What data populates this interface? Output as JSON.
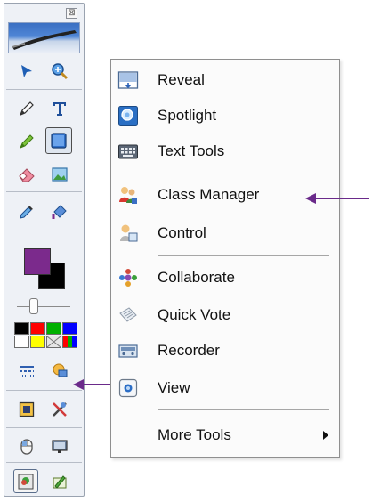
{
  "toolbox": {
    "close_glyph": "⊠",
    "icons": [
      "select-arrow-icon",
      "zoom-icon",
      "pen-icon",
      "text-icon",
      "highlighter-icon",
      "shape-icon",
      "eraser-icon",
      "image-icon",
      "eyedropper-icon",
      "fill-icon",
      "line-style-icon",
      "effects-icon",
      "reveal-tool-icon",
      "tools-icon",
      "mouse-icon",
      "screen-icon",
      "profile-icon",
      "pen-paper-icon"
    ],
    "foreground_color": "#7b2a8c",
    "background_color": "#000000",
    "palette_colors": [
      "#000000",
      "#ff0000",
      "#00b000",
      "#0000ff",
      "#ffffff",
      "#ffff00",
      "#d8d8d8",
      "#multi"
    ]
  },
  "menu": {
    "items": [
      {
        "label": "Reveal",
        "icon": "reveal-icon"
      },
      {
        "label": "Spotlight",
        "icon": "spotlight-icon"
      },
      {
        "label": "Text Tools",
        "icon": "keyboard-icon"
      },
      {
        "label": "Class Manager",
        "icon": "class-manager-icon"
      },
      {
        "label": "Control",
        "icon": "control-icon"
      },
      {
        "label": "Collaborate",
        "icon": "collaborate-icon"
      },
      {
        "label": "Quick Vote",
        "icon": "quick-vote-icon"
      },
      {
        "label": "Recorder",
        "icon": "recorder-icon"
      },
      {
        "label": "View",
        "icon": "view-icon"
      },
      {
        "label": "More Tools",
        "icon": ""
      }
    ]
  },
  "annotation_color": "#6a2a8a"
}
